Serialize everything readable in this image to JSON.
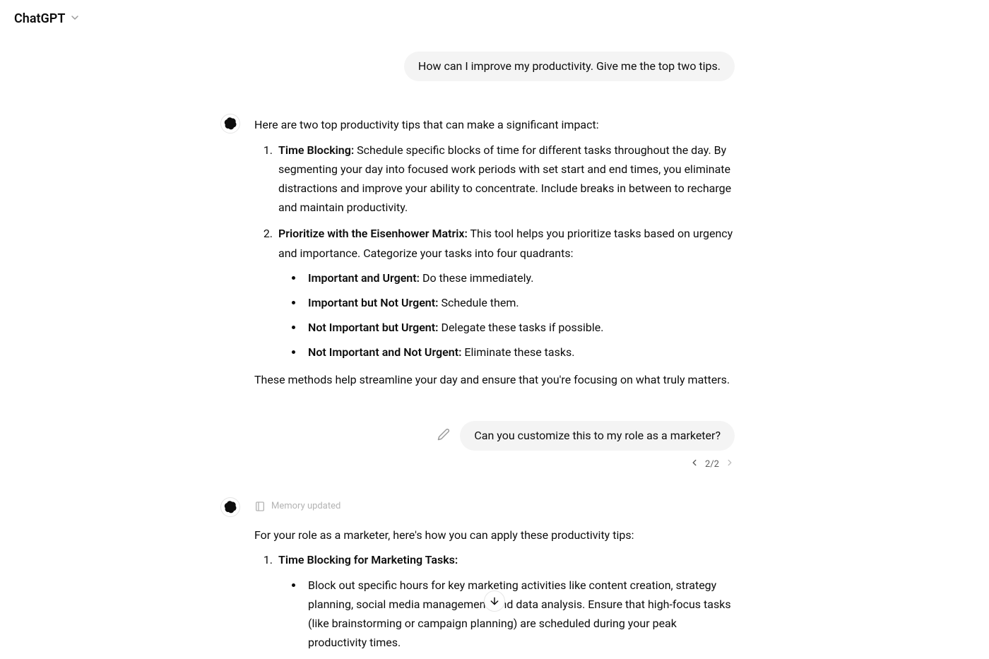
{
  "header": {
    "title": "ChatGPT"
  },
  "conversation": {
    "user1": "How can I improve my productivity. Give me the top two tips.",
    "assistant1": {
      "intro": "Here are two top productivity tips that can make a significant impact:",
      "point1_label": "Time Blocking:",
      "point1_text": " Schedule specific blocks of time for different tasks throughout the day. By segmenting your day into focused work periods with set start and end times, you eliminate distractions and improve your ability to concentrate. Include breaks in between to recharge and maintain productivity.",
      "point2_label": "Prioritize with the Eisenhower Matrix:",
      "point2_text": " This tool helps you prioritize tasks based on urgency and importance. Categorize your tasks into four quadrants:",
      "q1_label": "Important and Urgent:",
      "q1_text": " Do these immediately.",
      "q2_label": "Important but Not Urgent:",
      "q2_text": " Schedule them.",
      "q3_label": "Not Important but Urgent:",
      "q3_text": " Delegate these tasks if possible.",
      "q4_label": "Not Important and Not Urgent:",
      "q4_text": " Eliminate these tasks.",
      "outro": "These methods help streamline your day and ensure that you're focusing on what truly matters."
    },
    "user2": "Can you customize this to my role as a marketer?",
    "pagination": "2/2",
    "memory_updated": "Memory updated",
    "assistant2": {
      "intro": "For your role as a marketer, here's how you can apply these productivity tips:",
      "point1_label": "Time Blocking for Marketing Tasks:",
      "bullet1": "Block out specific hours for key marketing activities like content creation, strategy planning, social media management, and data analysis. Ensure that high-focus tasks (like brainstorming or campaign planning) are scheduled during your peak productivity times."
    }
  }
}
